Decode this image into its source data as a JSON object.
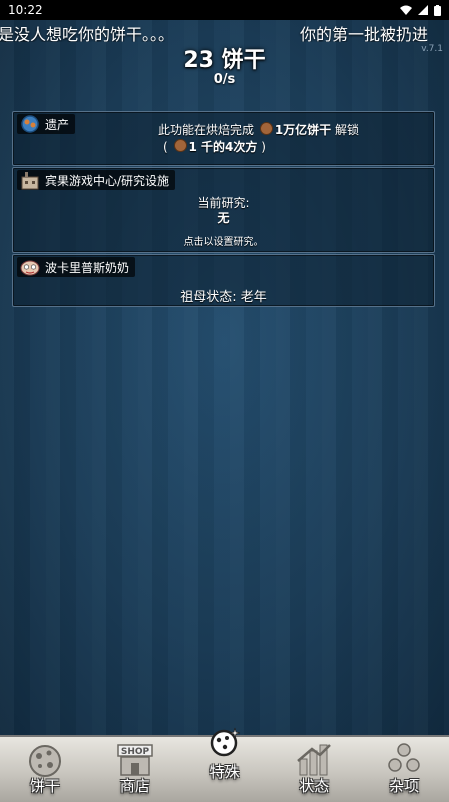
{
  "status_bar": {
    "time": "10:22"
  },
  "ticker": {
    "left": "是没人想吃你的饼干。。。",
    "right": "你的第一批被扔进"
  },
  "version": "v.7.1",
  "header": {
    "cookies": "23 饼干",
    "cps": "0/s"
  },
  "panels": [
    {
      "title": "遗产",
      "line1_a": "此功能在烘焙完成",
      "line1_b": "1万亿饼干",
      "line1_c": "解锁",
      "line2_a": "(",
      "line2_b": "1 千的4次方",
      "line2_c": ")"
    },
    {
      "title": "宾果游戏中心/研究设施",
      "label": "当前研究:",
      "value": "无",
      "hint": "点击以设置研究。"
    },
    {
      "title": "波卡里普斯奶奶",
      "status": "祖母状态:  老年"
    }
  ],
  "nav": [
    {
      "label": "饼干",
      "icon": "cookie-icon"
    },
    {
      "label": "商店",
      "icon": "shop-icon",
      "shop_sign": "SHOP"
    },
    {
      "label": "特殊",
      "icon": "special-icon"
    },
    {
      "label": "状态",
      "icon": "stats-icon"
    },
    {
      "label": "杂项",
      "icon": "misc-icon"
    }
  ]
}
